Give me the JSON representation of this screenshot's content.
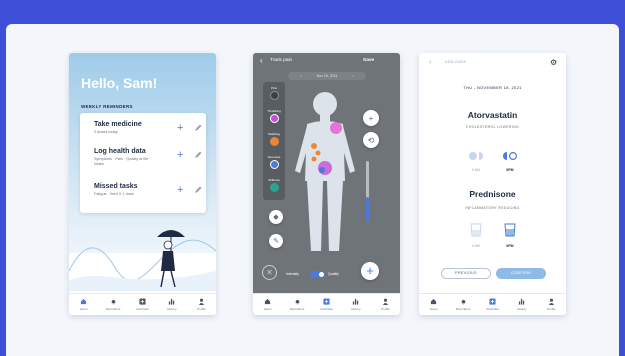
{
  "colors": {
    "accent": "#4f79d8",
    "background": "#3d4fd6",
    "canvas": "#f3f6fb"
  },
  "screen1": {
    "greeting": "Hello, Sam!",
    "section_title": "WEEKLY REMINDERS",
    "reminders": [
      {
        "title": "Take medicine",
        "subtitle": "2 doses today"
      },
      {
        "title": "Log health data",
        "subtitle": "Symptoms · Pain · Quality of life · Notes"
      },
      {
        "title": "Missed tasks",
        "subtitle": "Fatigue · Wed X 1 dose"
      }
    ],
    "nav": [
      {
        "label": "Home",
        "icon": "home-icon",
        "active": true
      },
      {
        "label": "Reminders",
        "icon": "bell-icon"
      },
      {
        "label": "Add Data",
        "icon": "plus-square-icon"
      },
      {
        "label": "History",
        "icon": "bar-chart-icon"
      },
      {
        "label": "Profile",
        "icon": "person-icon"
      }
    ]
  },
  "screen2": {
    "title": "Track pain",
    "save_label": "Save",
    "date": "Nov 18, 2021",
    "pain_types": [
      {
        "label": "Pins",
        "color": "#3c3f43"
      },
      {
        "label": "Throbbing",
        "color": "#c94fd1"
      },
      {
        "label": "Stabbing",
        "color": "#e8873a"
      },
      {
        "label": "Soreness",
        "color": "#4f79d8"
      },
      {
        "label": "Stiffness",
        "color": "#2aa58e"
      }
    ],
    "toggle_left": "Intensity",
    "toggle_right": "Quality",
    "nav": [
      {
        "label": "Home",
        "icon": "home-icon"
      },
      {
        "label": "Reminders",
        "icon": "bell-icon"
      },
      {
        "label": "Add Data",
        "icon": "plus-square-icon",
        "active": true
      },
      {
        "label": "History",
        "icon": "bar-chart-icon"
      },
      {
        "label": "Profile",
        "icon": "person-icon"
      }
    ]
  },
  "screen3": {
    "title": "ADD DATA",
    "date": "THU - NOVEMBER 18, 2021",
    "medications": [
      {
        "name": "Atorvastatin",
        "description": "CHOLESTEROL LOWERING",
        "doses": [
          {
            "time": "9 AM"
          },
          {
            "time": "6PM"
          }
        ]
      },
      {
        "name": "Prednisone",
        "description": "INFLAMMATORY REDUCING",
        "doses": [
          {
            "time": "9 AM"
          },
          {
            "time": "6PM"
          }
        ]
      }
    ],
    "previous_label": "PREVIOUS",
    "confirm_label": "CONFIRM",
    "nav": [
      {
        "label": "Home",
        "icon": "home-icon"
      },
      {
        "label": "Reminders",
        "icon": "bell-icon"
      },
      {
        "label": "Add Data",
        "icon": "plus-square-icon",
        "active": true
      },
      {
        "label": "History",
        "icon": "bar-chart-icon"
      },
      {
        "label": "Profile",
        "icon": "person-icon"
      }
    ]
  }
}
